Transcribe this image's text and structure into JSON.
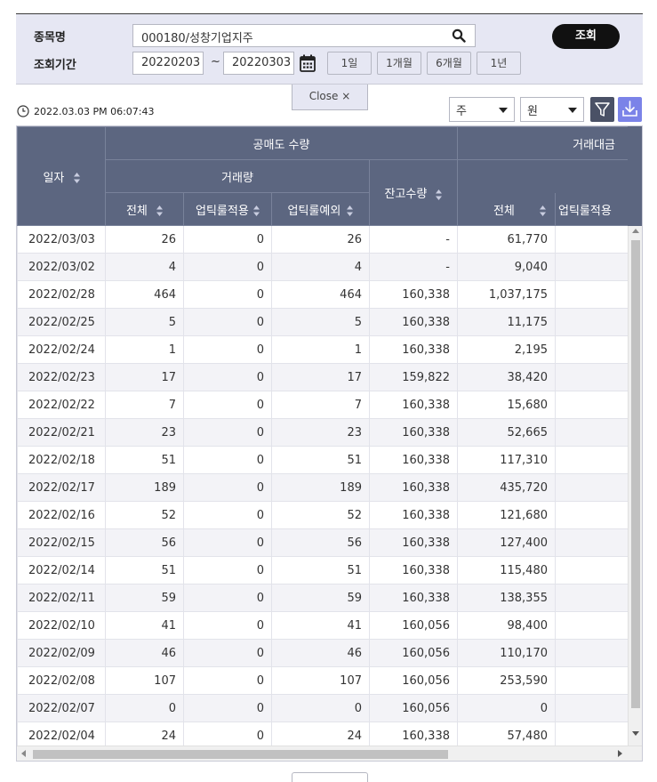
{
  "search": {
    "stock_label": "종목명",
    "stock_value": "000180/성창기업지주",
    "period_label": "조회기간",
    "start_date": "20220203",
    "tilde": "~",
    "end_date": "20220303",
    "query_label": "조회",
    "periods": [
      "1일",
      "1개월",
      "6개월",
      "1년"
    ]
  },
  "close_label": "Close ×",
  "timestamp": "2022.03.03 PM 06:07:43",
  "unit_select_1": "주",
  "unit_select_2": "원",
  "icons": {
    "search": "search-icon",
    "calendar": "calendar-icon",
    "clock": "clock-icon",
    "filter": "filter-icon",
    "download": "download-icon"
  },
  "colors": {
    "header_bg": "#5c6680",
    "panel_bg": "#e6e7f3",
    "query_btn": "#111111",
    "filter_btn": "#4a5166",
    "download_btn": "#7b83e8"
  },
  "table": {
    "headers": {
      "date": "일자",
      "short_sell_qty": "공매도 수량",
      "volume": "거래량",
      "total": "전체",
      "uptick_applied": "업틱룰적용",
      "uptick_excluded": "업틱룰예외",
      "balance_qty": "잔고수량",
      "trade_amount": "거래대금",
      "amount_total": "전체",
      "amount_uptick_applied": "업틱룰적용"
    },
    "rows": [
      [
        "2022/03/03",
        "26",
        "0",
        "26",
        "-",
        "61,770",
        ""
      ],
      [
        "2022/03/02",
        "4",
        "0",
        "4",
        "-",
        "9,040",
        ""
      ],
      [
        "2022/02/28",
        "464",
        "0",
        "464",
        "160,338",
        "1,037,175",
        ""
      ],
      [
        "2022/02/25",
        "5",
        "0",
        "5",
        "160,338",
        "11,175",
        ""
      ],
      [
        "2022/02/24",
        "1",
        "0",
        "1",
        "160,338",
        "2,195",
        ""
      ],
      [
        "2022/02/23",
        "17",
        "0",
        "17",
        "159,822",
        "38,420",
        ""
      ],
      [
        "2022/02/22",
        "7",
        "0",
        "7",
        "160,338",
        "15,680",
        ""
      ],
      [
        "2022/02/21",
        "23",
        "0",
        "23",
        "160,338",
        "52,665",
        ""
      ],
      [
        "2022/02/18",
        "51",
        "0",
        "51",
        "160,338",
        "117,310",
        ""
      ],
      [
        "2022/02/17",
        "189",
        "0",
        "189",
        "160,338",
        "435,720",
        ""
      ],
      [
        "2022/02/16",
        "52",
        "0",
        "52",
        "160,338",
        "121,680",
        ""
      ],
      [
        "2022/02/15",
        "56",
        "0",
        "56",
        "160,338",
        "127,400",
        ""
      ],
      [
        "2022/02/14",
        "51",
        "0",
        "51",
        "160,338",
        "115,480",
        ""
      ],
      [
        "2022/02/11",
        "59",
        "0",
        "59",
        "160,338",
        "138,355",
        ""
      ],
      [
        "2022/02/10",
        "41",
        "0",
        "41",
        "160,056",
        "98,400",
        ""
      ],
      [
        "2022/02/09",
        "46",
        "0",
        "46",
        "160,056",
        "110,170",
        ""
      ],
      [
        "2022/02/08",
        "107",
        "0",
        "107",
        "160,056",
        "253,590",
        ""
      ],
      [
        "2022/02/07",
        "0",
        "0",
        "0",
        "160,056",
        "0",
        ""
      ],
      [
        "2022/02/04",
        "24",
        "0",
        "24",
        "160,338",
        "57,480",
        ""
      ]
    ]
  }
}
